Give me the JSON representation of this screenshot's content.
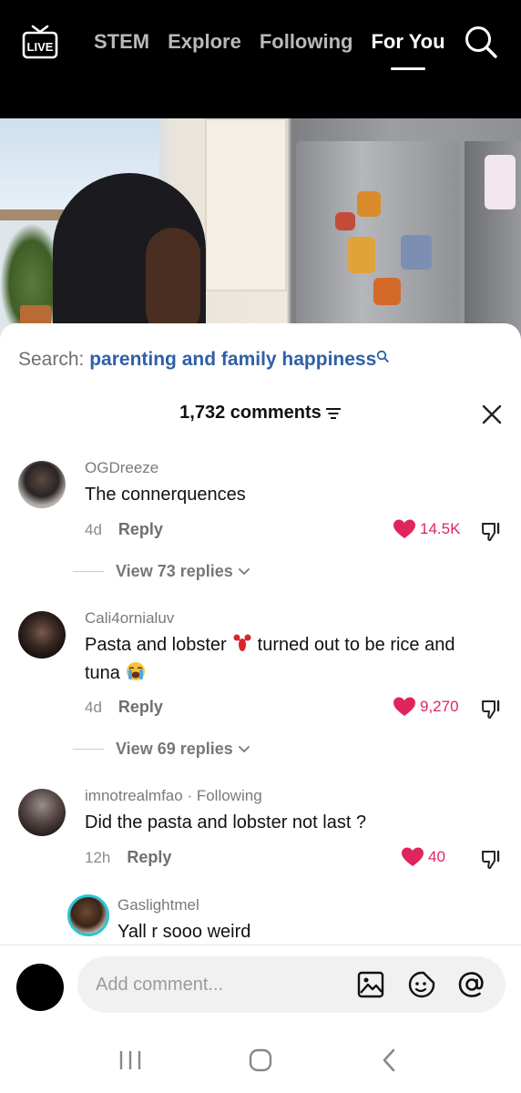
{
  "topnav": {
    "live_label": "LIVE",
    "tabs": [
      {
        "label": "STEM"
      },
      {
        "label": "Explore"
      },
      {
        "label": "Following"
      },
      {
        "label": "For You",
        "active": true
      }
    ]
  },
  "search": {
    "prefix": "Search:",
    "term": "parenting and family happiness"
  },
  "comments_header": {
    "count_label": "1,732 comments"
  },
  "comments": [
    {
      "username": "OGDreeze",
      "text": "The connerquences",
      "age": "4d",
      "reply_label": "Reply",
      "likes": "14.5K",
      "view_replies": "View 73 replies"
    },
    {
      "username": "Cali4ornialuv",
      "text_before_emoji": "Pasta and lobster",
      "emoji_1": "lobster-emoji",
      "text_after_emoji": "turned out to be rice and tuna",
      "emoji_2": "crying-face-emoji",
      "age": "4d",
      "reply_label": "Reply",
      "likes": "9,270",
      "view_replies": "View 69 replies"
    },
    {
      "username": "imnotrealmfao",
      "badge": "· Following",
      "text": "Did the pasta and lobster not last ?",
      "age": "12h",
      "reply_label": "Reply",
      "likes": "40"
    }
  ],
  "reply": {
    "username": "Gaslightmel",
    "text": "Yall r sooo weird"
  },
  "input": {
    "placeholder": "Add comment..."
  },
  "colors": {
    "like": "#e0245e",
    "search_term": "#2f5fa8"
  }
}
